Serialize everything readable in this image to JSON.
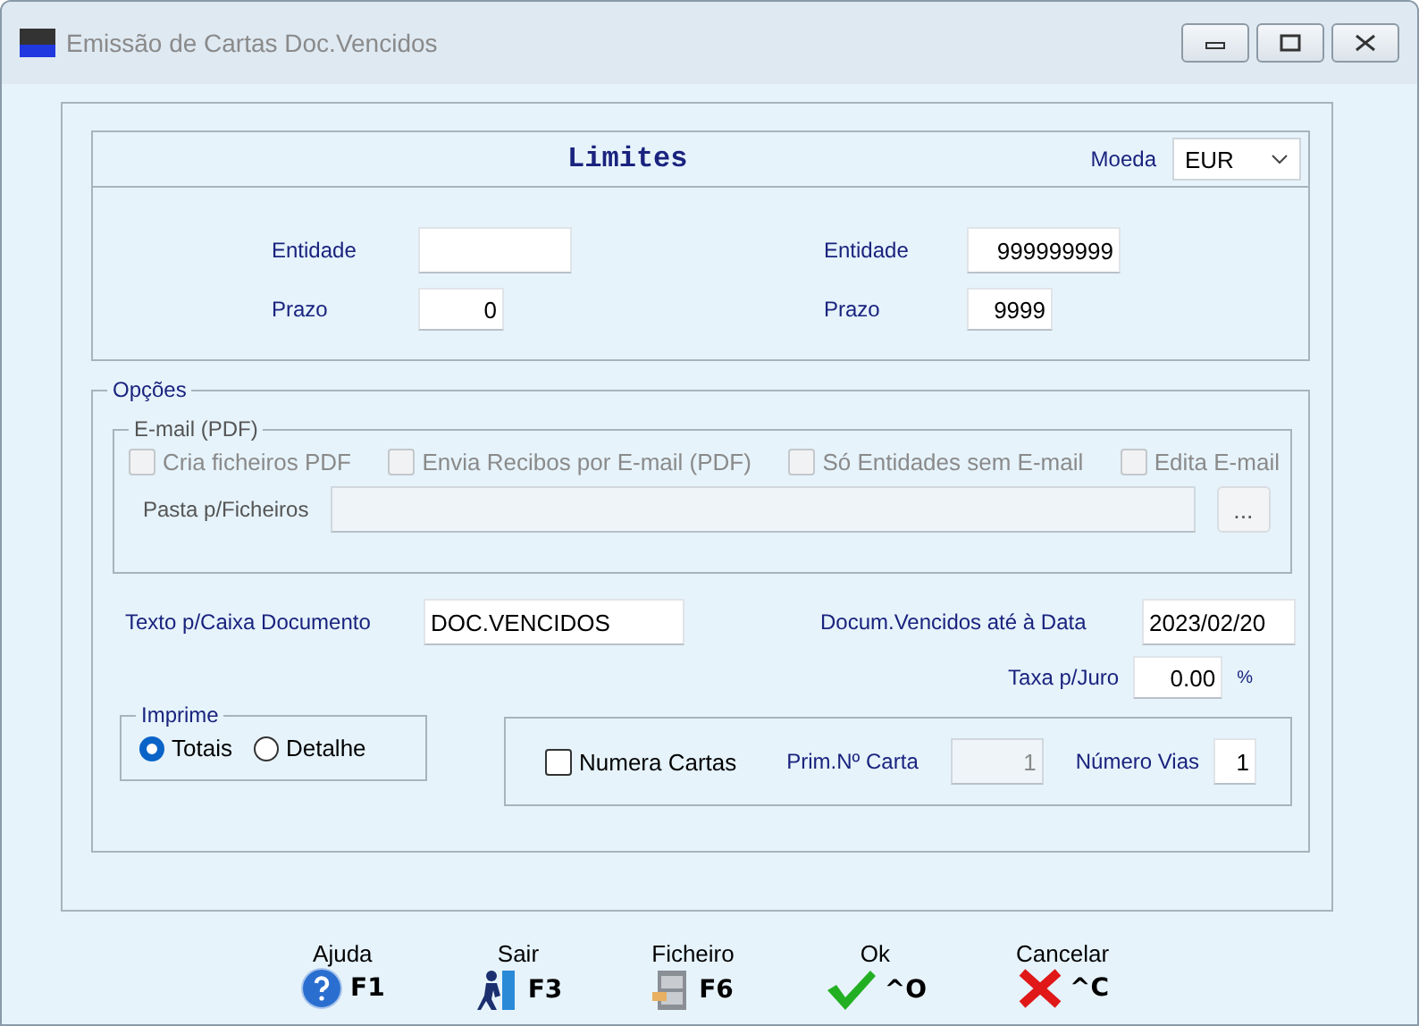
{
  "window": {
    "title": "Emissão de Cartas Doc.Vencidos"
  },
  "limites": {
    "title": "Limites",
    "currency_label": "Moeda",
    "currency": "EUR",
    "rows": [
      {
        "from_label": "Entidade",
        "from_value": "",
        "to_label": "Entidade",
        "to_value": "999999999",
        "kind": "wide"
      },
      {
        "from_label": "Prazo",
        "from_value": "0",
        "to_label": "Prazo",
        "to_value": "9999",
        "kind": "narrow"
      }
    ]
  },
  "opcoes": {
    "title": "Opções",
    "email": {
      "title": "E-mail (PDF)",
      "disabled": true,
      "checkboxes": [
        {
          "label": "Cria ficheiros PDF",
          "checked": false
        },
        {
          "label": "Envia Recibos por E-mail (PDF)",
          "checked": false
        },
        {
          "label": "Só Entidades sem E-mail",
          "checked": false
        },
        {
          "label": "Edita E-mail",
          "checked": false
        }
      ],
      "folder_label": "Pasta p/Ficheiros",
      "browse": "..."
    },
    "text_label": "Texto p/Caixa Documento",
    "text_value": "DOC.VENCIDOS",
    "date_label": "Docum.Vencidos até à Data",
    "date_value": "2023/02/20",
    "rate_label": "Taxa p/Juro",
    "rate_value": "0.00",
    "rate_unit": "%",
    "imprime": {
      "title": "Imprime",
      "options": [
        {
          "label": "Totais",
          "selected": true
        },
        {
          "label": "Detalhe",
          "selected": false
        }
      ]
    },
    "numera": {
      "label": "Numera Cartas",
      "checked": false,
      "first_label": "Prim.Nº Carta",
      "first_value": "1",
      "first_disabled": true,
      "copies_label": "Número Vias",
      "copies_value": "1"
    }
  },
  "buttons": [
    {
      "label": "Ajuda",
      "key": "F1",
      "kind": "help"
    },
    {
      "label": "Sair",
      "key": "F3",
      "kind": "exit"
    },
    {
      "label": "Ficheiro",
      "key": "F6",
      "kind": "file"
    },
    {
      "label": "Ok",
      "key": "^O",
      "kind": "ok"
    },
    {
      "label": "Cancelar",
      "key": "^C",
      "kind": "cancel"
    }
  ]
}
